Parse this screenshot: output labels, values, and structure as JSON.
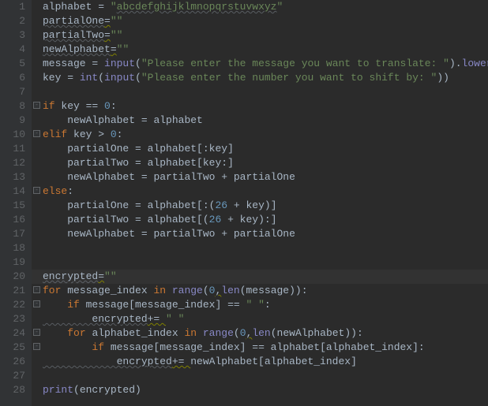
{
  "gutter": [
    "1",
    "2",
    "3",
    "4",
    "5",
    "6",
    "7",
    "8",
    "9",
    "10",
    "11",
    "12",
    "13",
    "14",
    "15",
    "16",
    "17",
    "18",
    "19",
    "20",
    "21",
    "22",
    "23",
    "24",
    "25",
    "26",
    "27",
    "28"
  ],
  "code": {
    "l1": {
      "a": "alphabet ",
      "b": "= ",
      "c": "\"",
      "d": "abcdefghijklmnopqrstuvwxyz",
      "e": "\""
    },
    "l2": {
      "a": "partialOne",
      "b": "=",
      "c": "\"\""
    },
    "l3": {
      "a": "partialTwo",
      "b": "=",
      "c": "\"\""
    },
    "l4": {
      "a": "newAlphabet",
      "b": "=",
      "c": "\"\""
    },
    "l5": {
      "a": "message ",
      "b": "= ",
      "c": "input",
      "d": "(",
      "e": "\"Please enter the message you want to translate: \"",
      "f": ").",
      "g": "lower",
      "h": "()"
    },
    "l6": {
      "a": "key ",
      "b": "= ",
      "c": "int",
      "d": "(",
      "e": "input",
      "f": "(",
      "g": "\"Please enter the number you want to shift by: \"",
      "h": "))"
    },
    "l8": {
      "a": "if ",
      "b": "key ",
      "c": "== ",
      "d": "0",
      "e": ":"
    },
    "l9": {
      "a": "    newAlphabet ",
      "b": "= ",
      "c": "alphabet"
    },
    "l10": {
      "a": "elif ",
      "b": "key ",
      "c": "> ",
      "d": "0",
      "e": ":"
    },
    "l11": {
      "a": "    partialOne ",
      "b": "= ",
      "c": "alphabet[",
      "d": ":",
      "e": "key]"
    },
    "l12": {
      "a": "    partialTwo ",
      "b": "= ",
      "c": "alphabet[key",
      "d": ":",
      "e": "]"
    },
    "l13": {
      "a": "    newAlphabet ",
      "b": "= ",
      "c": "partialTwo ",
      "d": "+ ",
      "e": "partialOne"
    },
    "l14": {
      "a": "else",
      "b": ":"
    },
    "l15": {
      "a": "    partialOne ",
      "b": "= ",
      "c": "alphabet[",
      "d": ":",
      "e": "(",
      "f": "26 ",
      "g": "+ ",
      "h": "key)]"
    },
    "l16": {
      "a": "    partialTwo ",
      "b": "= ",
      "c": "alphabet[(",
      "d": "26 ",
      "e": "+ ",
      "f": "key)",
      "g": ":",
      "h": "]"
    },
    "l17": {
      "a": "    newAlphabet ",
      "b": "= ",
      "c": "partialTwo ",
      "d": "+ ",
      "e": "partialOne"
    },
    "l20": {
      "a": "encrypted",
      "b": "=",
      "c": "\"\""
    },
    "l21": {
      "a": "for ",
      "b": "message_index ",
      "c": "in ",
      "d": "range",
      "e": "(",
      "f": "0",
      "g": ",",
      "h": "len",
      "i": "(message))",
      "j": ":"
    },
    "l22": {
      "a": "    ",
      "b": "if ",
      "c": "message[message_index] ",
      "d": "== ",
      "e": "\" \"",
      "f": ":"
    },
    "l23": {
      "a": "        encrypted",
      "b": "+= ",
      "c": "\" \""
    },
    "l24": {
      "a": "    ",
      "b": "for ",
      "c": "alphabet_index ",
      "d": "in ",
      "e": "range",
      "f": "(",
      "g": "0",
      "h": ",",
      "i": "len",
      "j": "(newAlphabet))",
      "k": ":"
    },
    "l25": {
      "a": "        ",
      "b": "if ",
      "c": "message[message_index] ",
      "d": "== ",
      "e": "alphabet[alphabet_index]",
      "f": ":"
    },
    "l26": {
      "a": "            encrypted",
      "b": "+= ",
      "c": "newAlphabet[alphabet_index]"
    },
    "l28": {
      "a": "print",
      "b": "(encrypted)"
    }
  }
}
